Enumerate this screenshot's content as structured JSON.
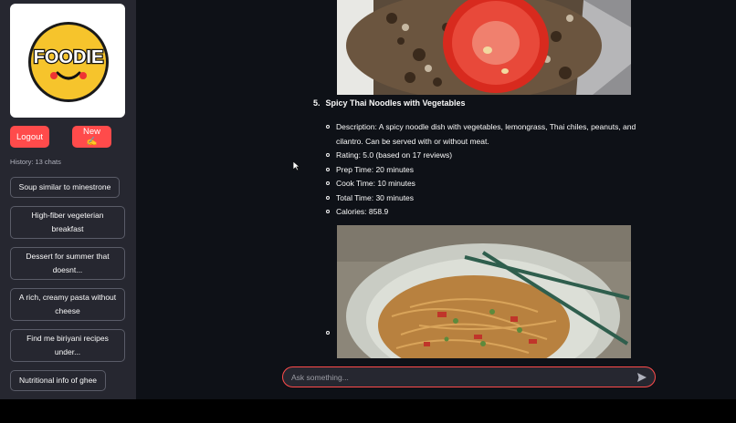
{
  "sidebar": {
    "logo_text": "FOODIE",
    "logout_label": "Logout",
    "new_label": "New ✍️",
    "history_label": "History: 13 chats",
    "chats": [
      "Soup similar to minestrone",
      "High-fiber vegeterian breakfast",
      "Dessert for summer that doesnt...",
      "A rich, creamy pasta without cheese",
      "Find me biriyani recipes under...",
      "Nutritional info of ghee"
    ]
  },
  "recipe": {
    "number": "5.",
    "title": "Spicy Thai Noodles with Vegetables",
    "details": [
      "Description: A spicy noodle dish with vegetables, lemongrass, Thai chiles, peanuts, and cilantro. Can be served with or without meat.",
      "Rating: 5.0 (based on 17 reviews)",
      "Prep Time: 20 minutes",
      "Cook Time: 10 minutes",
      "Total Time: 30 minutes",
      "Calories: 858.9"
    ]
  },
  "chat_input": {
    "placeholder": "Ask something..."
  },
  "colors": {
    "accent": "#ff4b4b",
    "sidebar_bg": "#262730",
    "main_bg": "#0e1117"
  }
}
